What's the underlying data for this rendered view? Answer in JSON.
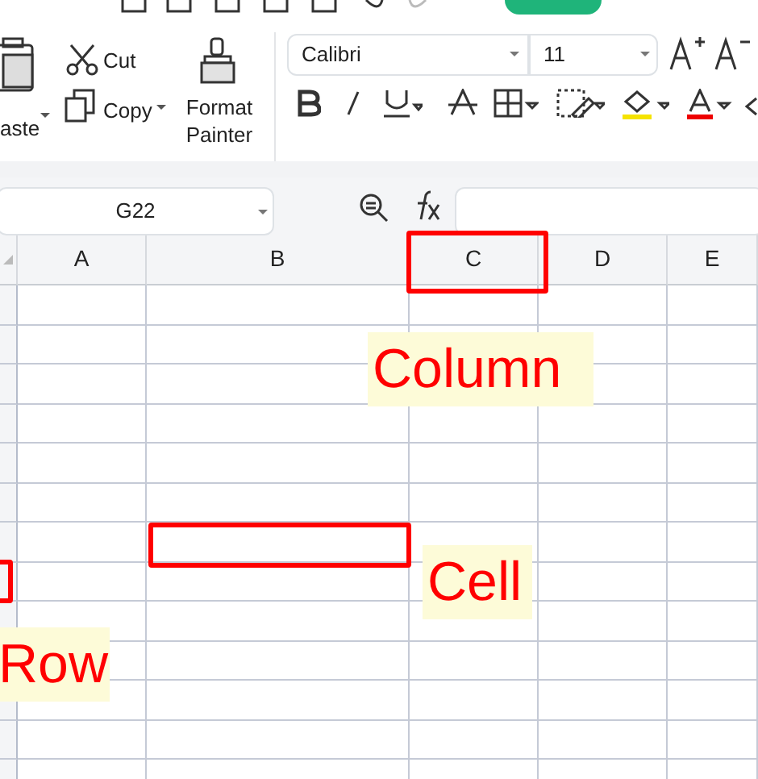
{
  "top_bar": {
    "tabs": [
      {
        "selected": true
      }
    ]
  },
  "ribbon": {
    "paste": "aste",
    "cut": "Cut",
    "copy": "Copy",
    "format_painter": "Format Painter",
    "font": {
      "name": "Calibri",
      "size": "11"
    }
  },
  "formula_bar": {
    "name_box": "G22"
  },
  "sheet": {
    "columns": [
      "A",
      "B",
      "C",
      "D",
      "E"
    ]
  },
  "annotations": [
    {
      "kind": "column",
      "label": "Column"
    },
    {
      "kind": "cell",
      "label": "Cell"
    },
    {
      "kind": "row",
      "label": "Row"
    }
  ]
}
